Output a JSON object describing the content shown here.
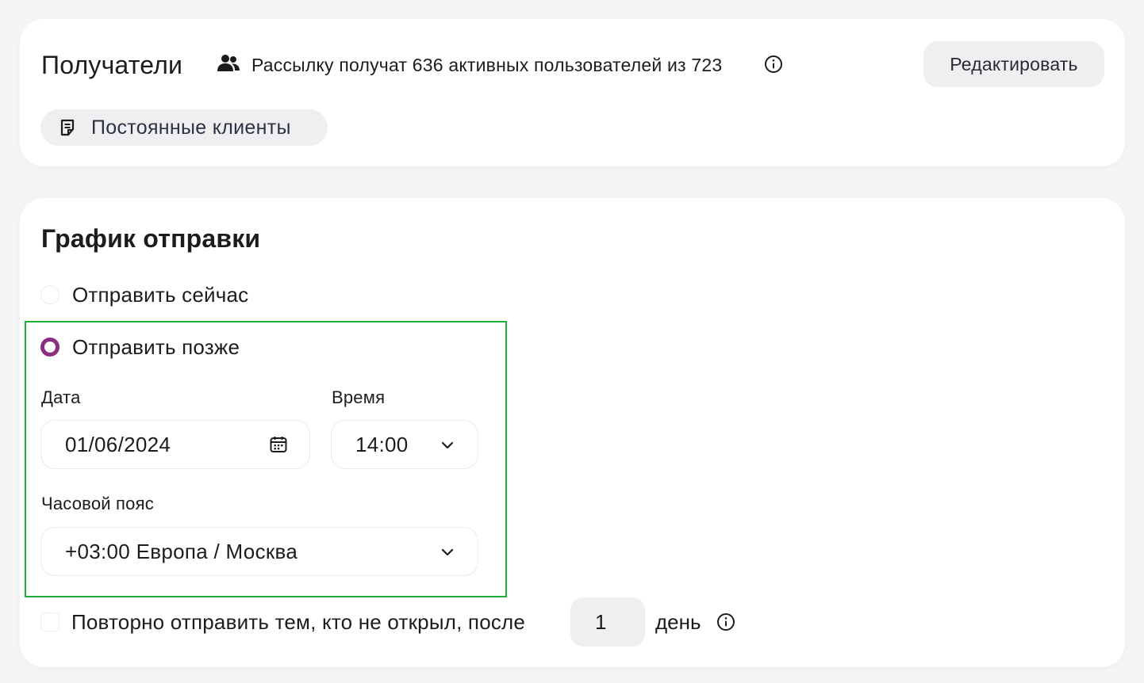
{
  "recipients": {
    "title": "Получатели",
    "summary": "Рассылку получат 636 активных пользователей из 723",
    "edit_label": "Редактировать",
    "segment_label": "Постоянные клиенты",
    "icons": {
      "users": "users-icon",
      "info": "info-icon",
      "segment": "document-icon"
    }
  },
  "schedule": {
    "title": "График отправки",
    "send_now_label": "Отправить сейчас",
    "send_later_label": "Отправить позже",
    "selected_option": "send_later",
    "date_label": "Дата",
    "date_value": "01/06/2024",
    "time_label": "Время",
    "time_value": "14:00",
    "timezone_label": "Часовой пояс",
    "timezone_value": "+03:00 Европа / Москва",
    "resend_label": "Повторно отправить тем, кто не открыл, после",
    "resend_days": "1",
    "resend_unit": "день",
    "resend_checked": false
  },
  "colors": {
    "accent_radio": "#8b2d7f",
    "highlight_border": "#1fae3a",
    "page_background": "#f5f5f7",
    "card_background": "#ffffff",
    "chip_background": "#efeff1"
  }
}
